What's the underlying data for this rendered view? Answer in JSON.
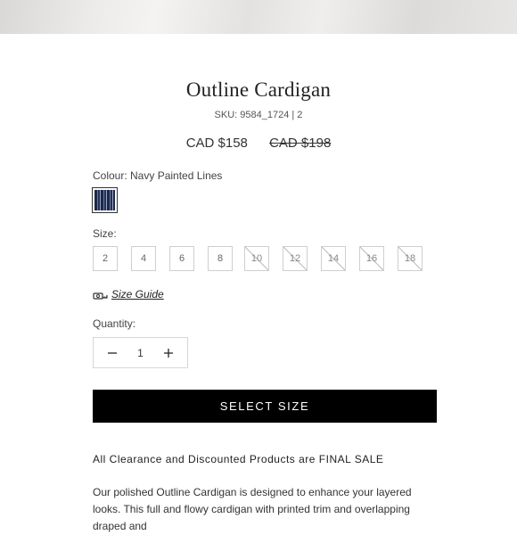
{
  "product": {
    "title": "Outline Cardigan",
    "sku": "SKU: 9584_1724 | 2",
    "price_current": "CAD $158",
    "price_original": "CAD $198"
  },
  "colour": {
    "label": "Colour: Navy Painted Lines",
    "swatch_icon": "navy-stripe-swatch",
    "swatch_colors": [
      "#1d2747",
      "#6f7aa0",
      "#22305a",
      "#9aa3c0"
    ]
  },
  "size": {
    "label": "Size:",
    "options": [
      {
        "value": "2",
        "available": true
      },
      {
        "value": "4",
        "available": true
      },
      {
        "value": "6",
        "available": true
      },
      {
        "value": "8",
        "available": true
      },
      {
        "value": "10",
        "available": false
      },
      {
        "value": "12",
        "available": false
      },
      {
        "value": "14",
        "available": false
      },
      {
        "value": "16",
        "available": false
      },
      {
        "value": "18",
        "available": false
      }
    ]
  },
  "size_guide": {
    "icon": "tape-measure-icon",
    "label": "Size Guide"
  },
  "quantity": {
    "label": "Quantity:",
    "value": "1",
    "decrement_icon": "minus-icon",
    "increment_icon": "plus-icon"
  },
  "cta": {
    "label": "SELECT SIZE"
  },
  "notice": "All Clearance and Discounted Products are FINAL SALE",
  "description": "Our polished Outline Cardigan is designed to enhance your layered looks. This full and flowy cardigan with printed trim and overlapping draped and"
}
